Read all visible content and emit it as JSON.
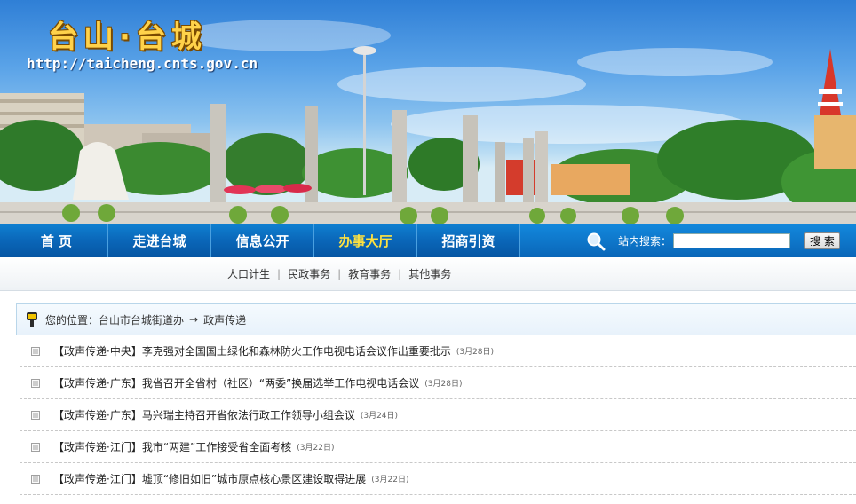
{
  "header": {
    "title": "台山·台城",
    "url": "http://taicheng.cnts.gov.cn"
  },
  "nav": {
    "items": [
      {
        "label": "首  页",
        "active": false
      },
      {
        "label": "走进台城",
        "active": false
      },
      {
        "label": "信息公开",
        "active": false
      },
      {
        "label": "办事大厅",
        "active": true
      },
      {
        "label": "招商引资",
        "active": false
      }
    ],
    "active_color": "#ffe240",
    "search": {
      "label": "站内搜索：",
      "value": "",
      "button_label": "搜 索",
      "icon": "magnifier-icon"
    }
  },
  "subnav": {
    "items": [
      "人口计生",
      "民政事务",
      "教育事务",
      "其他事务"
    ],
    "separator": "|"
  },
  "breadcrumb": {
    "prefix": "您的位置：",
    "items": [
      "台山市台城街道办",
      "政声传递"
    ],
    "arrow": "→",
    "icon": "location-pin-icon"
  },
  "news": [
    {
      "title": "【政声传递·中央】李克强对全国国土绿化和森林防火工作电视电话会议作出重要批示",
      "date": "(3月28日)"
    },
    {
      "title": "【政声传递·广东】我省召开全省村（社区）“两委”换届选举工作电视电话会议",
      "date": "(3月28日)"
    },
    {
      "title": "【政声传递·广东】马兴瑞主持召开省依法行政工作领导小组会议",
      "date": "(3月24日)"
    },
    {
      "title": "【政声传递·江门】我市“两建”工作接受省全面考核",
      "date": "(3月22日)"
    },
    {
      "title": "【政声传递·江门】墟顶“修旧如旧”城市原点核心景区建设取得进展",
      "date": "(3月22日)"
    }
  ]
}
